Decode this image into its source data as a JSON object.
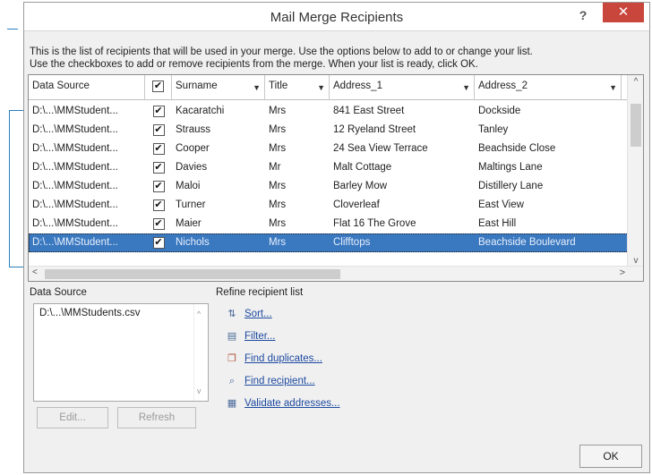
{
  "dialog": {
    "title": "Mail Merge Recipients",
    "help": "?",
    "close": "✕",
    "intro_line1": "This is the list of recipients that will be used in your merge.  Use the options below to add to or change your list.",
    "intro_line2": "Use the checkboxes to add or remove recipients from the merge.  When your list is ready, click OK."
  },
  "grid": {
    "columns": [
      "Data Source",
      "Surname",
      "Title",
      "Address_1",
      "Address_2"
    ],
    "rows": [
      {
        "source": "D:\\...\\MMStudent...",
        "checked": "✔",
        "surname": "Kacaratchi",
        "title": "Mrs",
        "address1": "841 East Street",
        "address2": "Dockside"
      },
      {
        "source": "D:\\...\\MMStudent...",
        "checked": "✔",
        "surname": "Strauss",
        "title": "Mrs",
        "address1": "12 Ryeland Street",
        "address2": "Tanley"
      },
      {
        "source": "D:\\...\\MMStudent...",
        "checked": "✔",
        "surname": "Cooper",
        "title": "Mrs",
        "address1": "24 Sea View Terrace",
        "address2": "Beachside Close"
      },
      {
        "source": "D:\\...\\MMStudent...",
        "checked": "✔",
        "surname": "Davies",
        "title": "Mr",
        "address1": "Malt Cottage",
        "address2": "Maltings Lane"
      },
      {
        "source": "D:\\...\\MMStudent...",
        "checked": "✔",
        "surname": "Maloi",
        "title": "Mrs",
        "address1": "Barley Mow",
        "address2": "Distillery Lane"
      },
      {
        "source": "D:\\...\\MMStudent...",
        "checked": "✔",
        "surname": "Turner",
        "title": "Mrs",
        "address1": "Cloverleaf",
        "address2": "East View"
      },
      {
        "source": "D:\\...\\MMStudent...",
        "checked": "✔",
        "surname": "Maier",
        "title": "Mrs",
        "address1": "Flat 16 The Grove",
        "address2": "East Hill"
      },
      {
        "source": "D:\\...\\MMStudent...",
        "checked": "✔",
        "surname": "Nichols",
        "title": "Mrs",
        "address1": "Clifftops",
        "address2": "Beachside Boulevard"
      }
    ],
    "header_check": "✔"
  },
  "datasource": {
    "label": "Data Source",
    "file": "D:\\...\\MMStudents.csv",
    "edit_label": "Edit...",
    "refresh_label": "Refresh"
  },
  "refine": {
    "label": "Refine recipient list",
    "sort": "Sort...",
    "filter": "Filter...",
    "find_duplicates": "Find duplicates...",
    "find_recipient": "Find recipient...",
    "validate": "Validate addresses..."
  },
  "ok_label": "OK",
  "colors": {
    "accent": "#2a7fbf",
    "selection": "#3a78c0",
    "close": "#c9463d",
    "link": "#1e4aa0"
  }
}
